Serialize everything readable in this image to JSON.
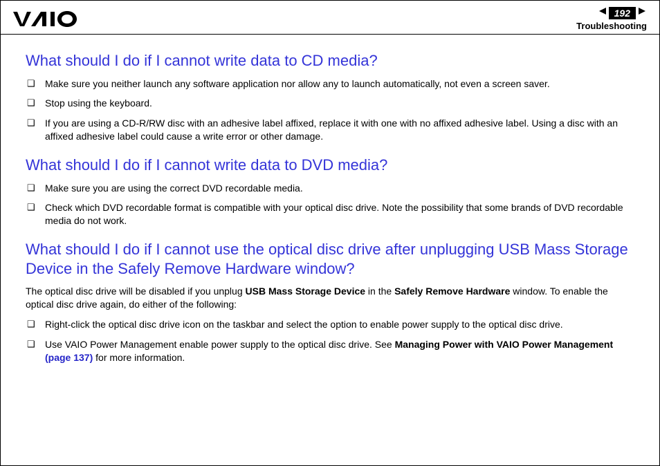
{
  "header": {
    "page_number": "192",
    "section": "Troubleshooting"
  },
  "sections": [
    {
      "heading": "What should I do if I cannot write data to CD media?",
      "items": [
        "Make sure you neither launch any software application nor allow any to launch automatically, not even a screen saver.",
        "Stop using the keyboard.",
        "If you are using a CD-R/RW disc with an adhesive label affixed, replace it with one with no affixed adhesive label. Using a disc with an affixed adhesive label could cause a write error or other damage."
      ]
    },
    {
      "heading": "What should I do if I cannot write data to DVD media?",
      "items": [
        "Make sure you are using the correct DVD recordable media.",
        "Check which DVD recordable format is compatible with your optical disc drive. Note the possibility that some brands of DVD recordable media do not work."
      ]
    }
  ],
  "section3": {
    "heading": "What should I do if I cannot use the optical disc drive after unplugging USB Mass Storage Device in the Safely Remove Hardware window?",
    "intro_pre": "The optical disc drive will be disabled if you unplug ",
    "intro_bold1": "USB Mass Storage Device",
    "intro_mid": " in the ",
    "intro_bold2": "Safely Remove Hardware",
    "intro_post": " window. To enable the optical disc drive again, do either of the following:",
    "item1": "Right-click the optical disc drive icon on the taskbar and select the option to enable power supply to the optical disc drive.",
    "item2_pre": "Use VAIO Power Management enable power supply to the optical disc drive. See ",
    "item2_bold": "Managing Power with VAIO Power Management",
    "item2_link": " (page 137)",
    "item2_post": " for more information."
  }
}
